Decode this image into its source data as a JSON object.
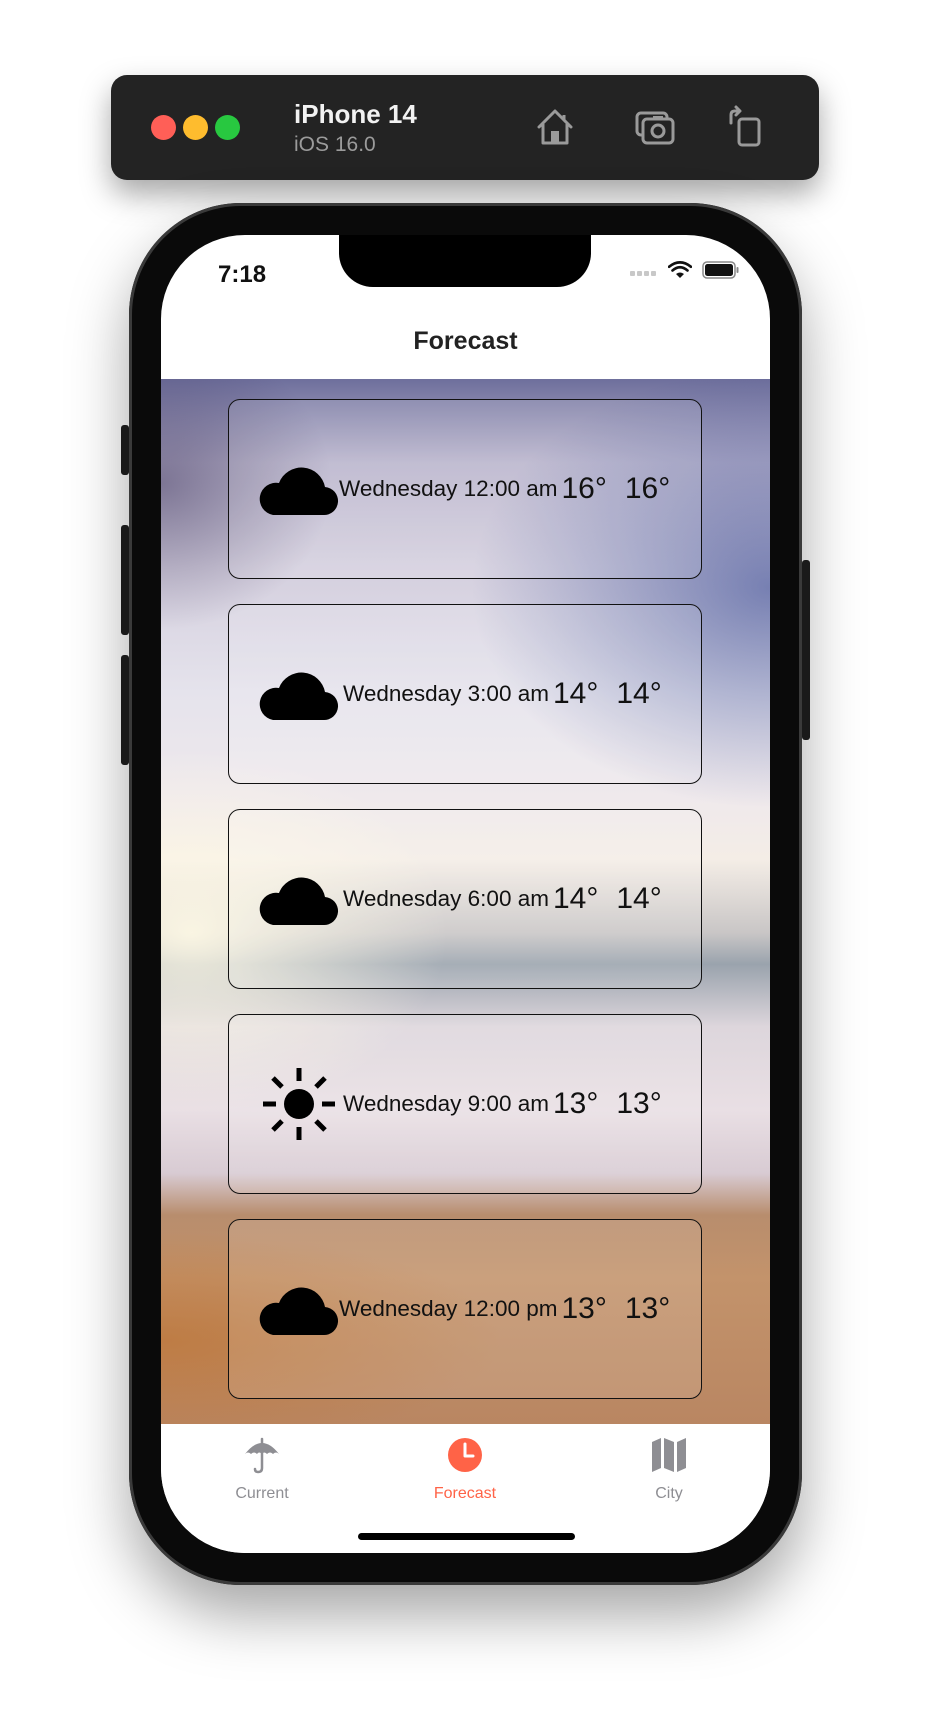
{
  "simulator": {
    "device_name": "iPhone 14",
    "os_version": "iOS 16.0",
    "toolbar_icons": [
      "home-icon",
      "screenshot-icon",
      "rotate-icon"
    ]
  },
  "status_bar": {
    "time": "7:18",
    "icons": [
      "cellular-icon",
      "wifi-icon",
      "battery-icon"
    ]
  },
  "nav": {
    "title": "Forecast"
  },
  "forecast": [
    {
      "icon": "cloud",
      "time": "Wednesday 12:00 am",
      "temp": "16°",
      "temp2": "16°"
    },
    {
      "icon": "cloud",
      "time": "Wednesday 3:00 am",
      "temp": "14°",
      "temp2": "14°"
    },
    {
      "icon": "cloud",
      "time": "Wednesday 6:00 am",
      "temp": "14°",
      "temp2": "14°"
    },
    {
      "icon": "sun",
      "time": "Wednesday 9:00 am",
      "temp": "13°",
      "temp2": "13°"
    },
    {
      "icon": "cloud",
      "time": "Wednesday 12:00 pm",
      "temp": "13°",
      "temp2": "13°"
    }
  ],
  "tabs": [
    {
      "label": "Current",
      "icon": "umbrella-icon",
      "active": false
    },
    {
      "label": "Forecast",
      "icon": "clock-icon",
      "active": true
    },
    {
      "label": "City",
      "icon": "map-icon",
      "active": false
    }
  ],
  "colors": {
    "accent": "#ff6347",
    "inactive": "#8e8e93"
  }
}
